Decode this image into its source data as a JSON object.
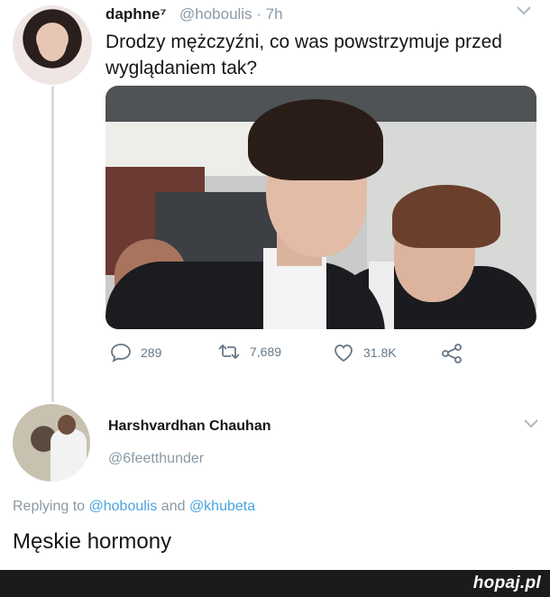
{
  "tweet": {
    "author_name": "daphne⁷",
    "author_handle": "@hoboulis · 7h",
    "text": "Drodzy mężczyźni, co was powstrzymuje przed wyglądaniem tak?",
    "actions": {
      "reply_count": "289",
      "retweet_count": "7,689",
      "like_count": "31.8K"
    }
  },
  "reply": {
    "author_name": "Harshvardhan Chauhan",
    "author_handle": "@6feetthunder",
    "replying_prefix": "Replying to ",
    "mention_1": "@hoboulis",
    "replying_join": " and ",
    "mention_2": "@khubeta",
    "text": "Męskie hormony"
  },
  "watermark": "hopaj.pl",
  "colors": {
    "mention": "#4aa3df",
    "muted": "#8899a6",
    "footer_bg": "#1b1b1b"
  },
  "icons": [
    "chevron-down-icon",
    "reply-icon",
    "retweet-icon",
    "like-icon",
    "share-icon"
  ]
}
